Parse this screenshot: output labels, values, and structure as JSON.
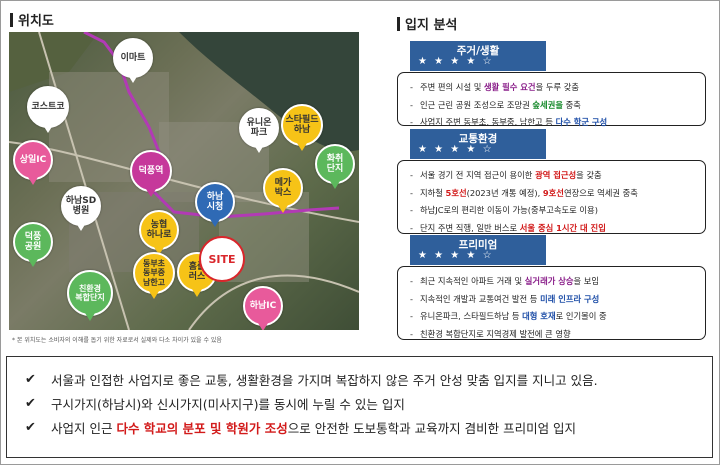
{
  "location_title": "위치도",
  "analysis_title": "입지 분석",
  "map": {
    "pins": [
      {
        "id": "emart",
        "label": "이마트",
        "color": "#ffffff",
        "text": "#333333"
      },
      {
        "id": "costco",
        "label": "코스트코",
        "color": "#ffffff",
        "text": "#333333"
      },
      {
        "id": "sangil-ic",
        "label": "상일IC",
        "color": "#e85a9b",
        "text": "#ffffff"
      },
      {
        "id": "hanam-sd",
        "label": "하남SD\n병원",
        "color": "#ffffff",
        "text": "#333333"
      },
      {
        "id": "deokpung-station",
        "label": "덕풍역",
        "color": "#c6389b",
        "text": "#ffffff"
      },
      {
        "id": "unique-park",
        "label": "유니온\n파크",
        "color": "#ffffff",
        "text": "#333333"
      },
      {
        "id": "starfield",
        "label": "스타필드\n하남",
        "color": "#f6c317",
        "text": "#333333"
      },
      {
        "id": "hwachwi",
        "label": "화취\n단지",
        "color": "#5cb85c",
        "text": "#ffffff"
      },
      {
        "id": "mega-box",
        "label": "메가\n박스",
        "color": "#f6c317",
        "text": "#333333"
      },
      {
        "id": "hanam-city-hall",
        "label": "하남\n시청",
        "color": "#2f6ab5",
        "text": "#ffffff"
      },
      {
        "id": "nonghyup",
        "label": "농협\n하나로",
        "color": "#f6c317",
        "text": "#333333"
      },
      {
        "id": "deokpung-park",
        "label": "덕풍\n공원",
        "color": "#5cb85c",
        "text": "#ffffff"
      },
      {
        "id": "dongbu-schools",
        "label": "동부초\n동부중\n남한고",
        "color": "#f6c317",
        "text": "#333333"
      },
      {
        "id": "homeplus",
        "label": "홈플\n러스",
        "color": "#f6c317",
        "text": "#333333"
      },
      {
        "id": "eco-complex",
        "label": "친환경\n복합단지",
        "color": "#5cb85c",
        "text": "#ffffff"
      },
      {
        "id": "hanam-ic",
        "label": "하남IC",
        "color": "#e85a9b",
        "text": "#ffffff"
      }
    ],
    "site_label": "SITE",
    "note": "* 본 위치도는 소비자의 이해를 돕기 위한 자료로서 실제와 다소 차이가 있을 수 있음"
  },
  "categories": [
    {
      "label": "주거/생활",
      "stars": "★ ★ ★ ★ ☆",
      "items": [
        [
          {
            "t": "주변 편의 시설 및 "
          },
          {
            "t": "생활 필수 요건",
            "c": "hl-purple"
          },
          {
            "t": "을 두루 갖춤"
          }
        ],
        [
          {
            "t": "인근 근린 공원 조성으로 조망권 "
          },
          {
            "t": "숲세권을",
            "c": "hl-green"
          },
          {
            "t": " 중축"
          }
        ],
        [
          {
            "t": "사업지 주변 동부초, 동부중, 남한고 등 "
          },
          {
            "t": "다수 학군 구성",
            "c": "hl-blue"
          }
        ]
      ]
    },
    {
      "label": "교통환경",
      "stars": "★ ★ ★ ★ ☆",
      "items": [
        [
          {
            "t": "서울 경기 전 지역 접근이 용이한 "
          },
          {
            "t": "광역 접근성",
            "c": "hl-red"
          },
          {
            "t": "을 갖춤"
          }
        ],
        [
          {
            "t": "지하철 "
          },
          {
            "t": "5호선",
            "c": "hl-red"
          },
          {
            "t": "(2023년 개통 예정), "
          },
          {
            "t": "9호선",
            "c": "hl-red"
          },
          {
            "t": "연장으로 역세권 중축"
          }
        ],
        [
          {
            "t": "하남JC로의 편리한 이동이 가능(중부고속도로 이용)"
          }
        ],
        [
          {
            "t": "단지 주변 직행, 일반 버스로 "
          },
          {
            "t": "서울 중심 1시간 대 진입",
            "c": "hl-red"
          }
        ]
      ]
    },
    {
      "label": "프리미엄",
      "stars": "★ ★ ★ ★ ☆",
      "items": [
        [
          {
            "t": "최근 지속적인 아파트 거래 및 "
          },
          {
            "t": "실거래가 상승",
            "c": "hl-purple"
          },
          {
            "t": "을 보임"
          }
        ],
        [
          {
            "t": "지속적인 개발과 교통여건 발전 등 "
          },
          {
            "t": "미래 인프라 구성",
            "c": "hl-blue"
          }
        ],
        [
          {
            "t": "유니온파크, 스타필드하남 등 "
          },
          {
            "t": "대형 호재",
            "c": "hl-blue"
          },
          {
            "t": "로 인기몰이 중"
          }
        ],
        [
          {
            "t": "친환경 복합단지로 지역경제 발전에 큰 영향"
          }
        ]
      ]
    }
  ],
  "summary": [
    [
      {
        "t": "서울과 인접한 사업지로 좋은 교통, 생활환경을 가지며 복잡하지 않은 주거 안성 맞춤 입지를 지니고 있음."
      }
    ],
    [
      {
        "t": "구시가지(하남시)와 신시가지(미사지구)를 동시에 누릴 수 있는 입지"
      }
    ],
    [
      {
        "t": "사업지 인근 "
      },
      {
        "t": "다수 학교의 분포 및 학원가 조성",
        "c": "em"
      },
      {
        "t": "으로 안전한 도보통학과 교육까지 겸비한 프리미엄 입지"
      }
    ]
  ],
  "check_glyph": "✔"
}
